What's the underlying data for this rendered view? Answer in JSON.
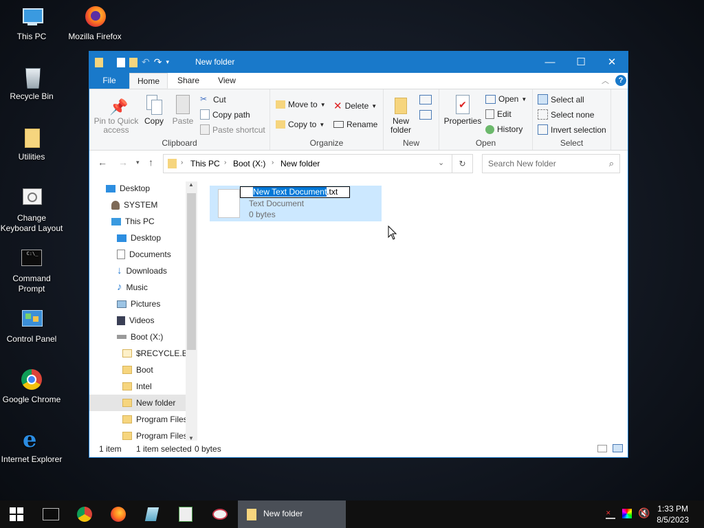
{
  "desktop": {
    "icons": [
      {
        "label": "This PC"
      },
      {
        "label": "Mozilla Firefox"
      },
      {
        "label": "Recycle Bin"
      },
      {
        "label": "Utilities"
      },
      {
        "label": "Change Keyboard Layout"
      },
      {
        "label": "Command Prompt"
      },
      {
        "label": "Control Panel"
      },
      {
        "label": "Google Chrome"
      },
      {
        "label": "Internet Explorer"
      }
    ]
  },
  "window": {
    "title": "New folder",
    "controls": {
      "minimize": "—",
      "maximize": "☐",
      "close": "✕"
    }
  },
  "ribbon": {
    "tabs": {
      "file": "File",
      "home": "Home",
      "share": "Share",
      "view": "View"
    },
    "clipboard": {
      "pin": "Pin to Quick access",
      "copy": "Copy",
      "paste": "Paste",
      "cut": "Cut",
      "copy_path": "Copy path",
      "paste_shortcut": "Paste shortcut",
      "label": "Clipboard"
    },
    "organize": {
      "move_to": "Move to",
      "copy_to": "Copy to",
      "delete": "Delete",
      "rename": "Rename",
      "label": "Organize"
    },
    "new": {
      "new_folder": "New folder",
      "label": "New"
    },
    "open": {
      "properties": "Properties",
      "open": "Open",
      "edit": "Edit",
      "history": "History",
      "label": "Open"
    },
    "select": {
      "select_all": "Select all",
      "select_none": "Select none",
      "invert": "Invert selection",
      "label": "Select"
    }
  },
  "address": {
    "crumbs": [
      "This PC",
      "Boot (X:)",
      "New folder"
    ],
    "search_placeholder": "Search New folder"
  },
  "navpane": {
    "items": [
      {
        "label": "Desktop"
      },
      {
        "label": "SYSTEM"
      },
      {
        "label": "This PC"
      },
      {
        "label": "Desktop"
      },
      {
        "label": "Documents"
      },
      {
        "label": "Downloads"
      },
      {
        "label": "Music"
      },
      {
        "label": "Pictures"
      },
      {
        "label": "Videos"
      },
      {
        "label": "Boot (X:)"
      },
      {
        "label": "$RECYCLE.BIN"
      },
      {
        "label": "Boot"
      },
      {
        "label": "Intel"
      },
      {
        "label": "New folder"
      },
      {
        "label": "Program Files"
      },
      {
        "label": "Program Files"
      }
    ]
  },
  "content": {
    "file": {
      "name_selected": "New Text Document",
      "name_ext": ".txt",
      "type": "Text Document",
      "size": "0 bytes"
    }
  },
  "status": {
    "count": "1 item",
    "selected": "1 item selected",
    "size": "0 bytes"
  },
  "taskbar": {
    "active_window": "New folder",
    "time": "1:33 PM",
    "date": "8/5/2023"
  },
  "colors": {
    "accent": "#1979ca",
    "selection": "#cce8ff",
    "highlight": "#0078d7"
  }
}
